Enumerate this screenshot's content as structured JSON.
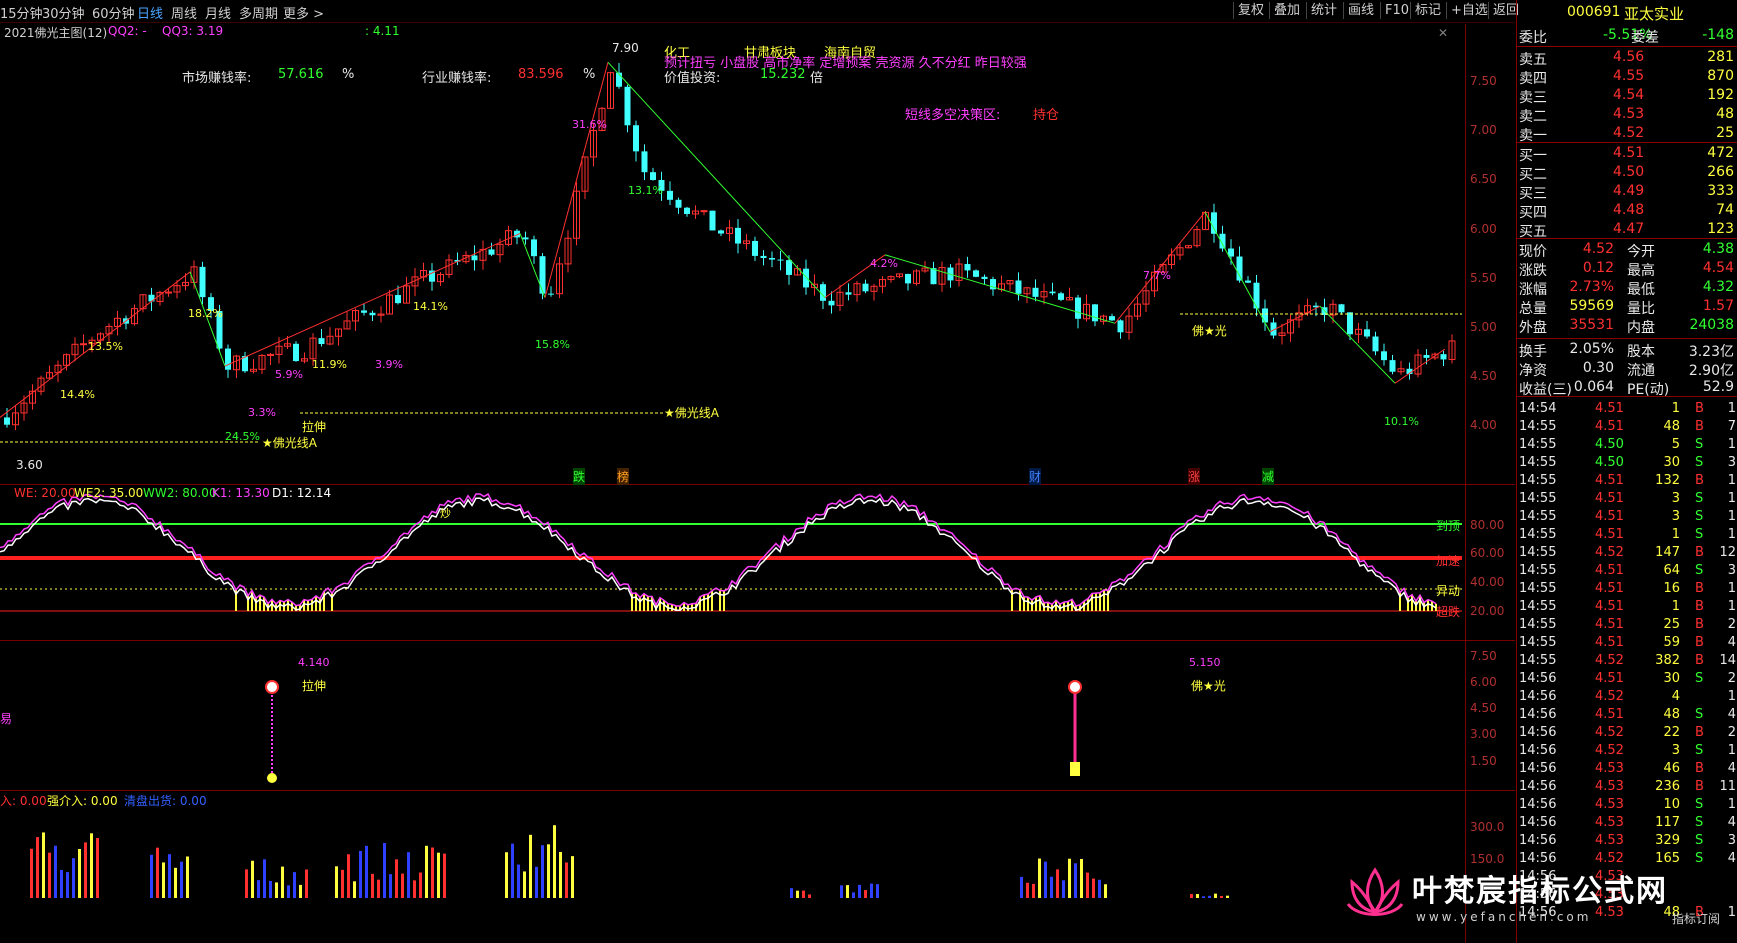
{
  "toolbar": {
    "periods": [
      "15分钟",
      "30分钟",
      "60分钟",
      "日线",
      "周线",
      "月线",
      "多周期",
      "更多 >"
    ],
    "active_period": "日线",
    "buttons": [
      "复权",
      "叠加",
      "统计",
      "画线",
      "F10",
      "标记",
      "+自选",
      "返回"
    ]
  },
  "stock": {
    "code": "000691",
    "name": "亚太实业"
  },
  "main_chart": {
    "indicator_name": "2021佛光主图(12)",
    "qq2": "QQ2: -",
    "qq3": "QQ3: 3.19",
    "extra_val": ": 4.11",
    "market_win_label": "市场赚钱率:",
    "market_win_val": "57.616",
    "market_win_unit": "%",
    "industry_win_label": "行业赚钱率:",
    "industry_win_val": "83.596",
    "industry_win_unit": "%",
    "concepts_row1": [
      "化工",
      "甘肃板块",
      "海南自贸"
    ],
    "concepts_row2": "预计扭亏 小盘股 高市净率 定增预案 壳资源 久不分红 昨日较强",
    "value_invest_label": "价值投资:",
    "value_invest_val": "15.232",
    "value_invest_unit": "倍",
    "strategy_label": "短线多空决策区:",
    "strategy_val": "持仓",
    "high_label": "7.90",
    "low_label": "3.60",
    "fgx_label": "★佛光线A",
    "lashen_label": "拉伸",
    "foguang_label": "佛★光",
    "pct_labels": [
      "13.5%",
      "14.4%",
      "18.2%",
      "24.5%",
      "5.9%",
      "3.3%",
      "11.9%",
      "3.9%",
      "14.1%",
      "15.8%",
      "31.6%",
      "13.1%",
      "4.2%",
      "7.7%",
      "10.1%"
    ],
    "bottom_marks": [
      "跌",
      "榜",
      "财",
      "涨",
      "减"
    ],
    "y_ticks": [
      "7.50",
      "7.00",
      "6.50",
      "6.00",
      "5.50",
      "5.00",
      "4.50",
      "4.00"
    ]
  },
  "kdj_panel": {
    "labels": [
      {
        "text": "WE: 20.00",
        "color": "#ff3030"
      },
      {
        "text": "WE2: 35.00",
        "color": "#ffff40"
      },
      {
        "text": "WW2: 80.00",
        "color": "#30ff30"
      },
      {
        "text": "K1: 13.30",
        "color": "#ff40ff"
      },
      {
        "text": "D1: 12.14",
        "color": "#ffffff"
      }
    ],
    "right_labels": [
      "到顶",
      "加速",
      "异动",
      "超跌"
    ],
    "y_ticks": [
      "80.00",
      "60.00",
      "40.00",
      "20.00"
    ],
    "top_marker": "炒"
  },
  "signal_panel": {
    "label_left": "易",
    "sig1_price": "4.140",
    "sig1_label": "拉伸",
    "sig2_price": "5.150",
    "sig2_label": "佛★光",
    "y_ticks": [
      "7.50",
      "6.00",
      "4.50",
      "3.00",
      "1.50"
    ]
  },
  "vol_panel": {
    "labels": [
      {
        "text": "入: 0.00",
        "color": "#ff3030"
      },
      {
        "text": "强介入: 0.00",
        "color": "#ffff40"
      },
      {
        "text": "清盘出货: 0.00",
        "color": "#3060ff"
      }
    ],
    "y_ticks": [
      "300.0",
      "150.0"
    ]
  },
  "quote": {
    "wb_label": "委比",
    "wb_val": "-5.51%",
    "wc_label": "委差",
    "wc_val": "-148",
    "asks": [
      {
        "label": "卖五",
        "price": "4.56",
        "vol": "281"
      },
      {
        "label": "卖四",
        "price": "4.55",
        "vol": "870"
      },
      {
        "label": "卖三",
        "price": "4.54",
        "vol": "192"
      },
      {
        "label": "卖二",
        "price": "4.53",
        "vol": "48"
      },
      {
        "label": "卖一",
        "price": "4.52",
        "vol": "25"
      }
    ],
    "bids": [
      {
        "label": "买一",
        "price": "4.51",
        "vol": "472"
      },
      {
        "label": "买二",
        "price": "4.50",
        "vol": "266"
      },
      {
        "label": "买三",
        "price": "4.49",
        "vol": "333"
      },
      {
        "label": "买四",
        "price": "4.48",
        "vol": "74"
      },
      {
        "label": "买五",
        "price": "4.47",
        "vol": "123"
      }
    ],
    "stats": [
      {
        "l1": "现价",
        "v1": "4.52",
        "c1": "red",
        "l2": "今开",
        "v2": "4.38",
        "c2": "green"
      },
      {
        "l1": "涨跌",
        "v1": "0.12",
        "c1": "red",
        "l2": "最高",
        "v2": "4.54",
        "c2": "red"
      },
      {
        "l1": "涨幅",
        "v1": "2.73%",
        "c1": "red",
        "l2": "最低",
        "v2": "4.32",
        "c2": "green"
      },
      {
        "l1": "总量",
        "v1": "59569",
        "c1": "yellow",
        "l2": "量比",
        "v2": "1.57",
        "c2": "red"
      },
      {
        "l1": "外盘",
        "v1": "35531",
        "c1": "red",
        "l2": "内盘",
        "v2": "24038",
        "c2": "green"
      }
    ],
    "stats2": [
      {
        "l1": "换手",
        "v1": "2.05%",
        "c1": "white",
        "l2": "股本",
        "v2": "3.23亿",
        "c2": "white"
      },
      {
        "l1": "净资",
        "v1": "0.30",
        "c1": "white",
        "l2": "流通",
        "v2": "2.90亿",
        "c2": "white"
      },
      {
        "l1": "收益(三)",
        "v1": "0.064",
        "c1": "white",
        "l2": "PE(动)",
        "v2": "52.9",
        "c2": "white"
      }
    ],
    "ticks": [
      {
        "t": "14:54",
        "p": "4.51",
        "v": "1",
        "d": "B",
        "n": "1"
      },
      {
        "t": "14:55",
        "p": "4.51",
        "v": "48",
        "d": "B",
        "n": "7"
      },
      {
        "t": "14:55",
        "p": "4.50",
        "v": "5",
        "d": "S",
        "n": "1"
      },
      {
        "t": "14:55",
        "p": "4.50",
        "v": "30",
        "d": "S",
        "n": "3"
      },
      {
        "t": "14:55",
        "p": "4.51",
        "v": "132",
        "d": "B",
        "n": "1"
      },
      {
        "t": "14:55",
        "p": "4.51",
        "v": "3",
        "d": "S",
        "n": "1"
      },
      {
        "t": "14:55",
        "p": "4.51",
        "v": "3",
        "d": "S",
        "n": "1"
      },
      {
        "t": "14:55",
        "p": "4.51",
        "v": "1",
        "d": "S",
        "n": "1"
      },
      {
        "t": "14:55",
        "p": "4.52",
        "v": "147",
        "d": "B",
        "n": "12"
      },
      {
        "t": "14:55",
        "p": "4.51",
        "v": "64",
        "d": "S",
        "n": "3"
      },
      {
        "t": "14:55",
        "p": "4.51",
        "v": "16",
        "d": "B",
        "n": "1"
      },
      {
        "t": "14:55",
        "p": "4.51",
        "v": "1",
        "d": "B",
        "n": "1"
      },
      {
        "t": "14:55",
        "p": "4.51",
        "v": "25",
        "d": "B",
        "n": "2"
      },
      {
        "t": "14:55",
        "p": "4.51",
        "v": "59",
        "d": "B",
        "n": "4"
      },
      {
        "t": "14:55",
        "p": "4.52",
        "v": "382",
        "d": "B",
        "n": "14"
      },
      {
        "t": "14:56",
        "p": "4.51",
        "v": "30",
        "d": "S",
        "n": "2"
      },
      {
        "t": "14:56",
        "p": "4.52",
        "v": "4",
        "d": "",
        "n": "1"
      },
      {
        "t": "14:56",
        "p": "4.51",
        "v": "48",
        "d": "S",
        "n": "4"
      },
      {
        "t": "14:56",
        "p": "4.52",
        "v": "22",
        "d": "B",
        "n": "2"
      },
      {
        "t": "14:56",
        "p": "4.52",
        "v": "3",
        "d": "S",
        "n": "1"
      },
      {
        "t": "14:56",
        "p": "4.53",
        "v": "46",
        "d": "B",
        "n": "4"
      },
      {
        "t": "14:56",
        "p": "4.53",
        "v": "236",
        "d": "B",
        "n": "11"
      },
      {
        "t": "14:56",
        "p": "4.53",
        "v": "10",
        "d": "S",
        "n": "1"
      },
      {
        "t": "14:56",
        "p": "4.53",
        "v": "117",
        "d": "S",
        "n": "4"
      },
      {
        "t": "14:56",
        "p": "4.53",
        "v": "329",
        "d": "S",
        "n": "3"
      },
      {
        "t": "14:56",
        "p": "4.52",
        "v": "165",
        "d": "S",
        "n": "4"
      },
      {
        "t": "14:56",
        "p": "4.53",
        "v": "",
        "d": "",
        "n": ""
      },
      {
        "t": "14:56",
        "p": "4.53",
        "v": "",
        "d": "",
        "n": ""
      },
      {
        "t": "14:56",
        "p": "4.53",
        "v": "48",
        "d": "B",
        "n": "1"
      }
    ]
  },
  "watermark": {
    "brand": "叶梵宸指标公式网",
    "url": "www.yefanchen.com",
    "slogan": "指标订阅"
  },
  "colors": {
    "up": "#ff3030",
    "down": "#40ffff",
    "frame": "#7a0000",
    "active": "#4aa3ff"
  }
}
